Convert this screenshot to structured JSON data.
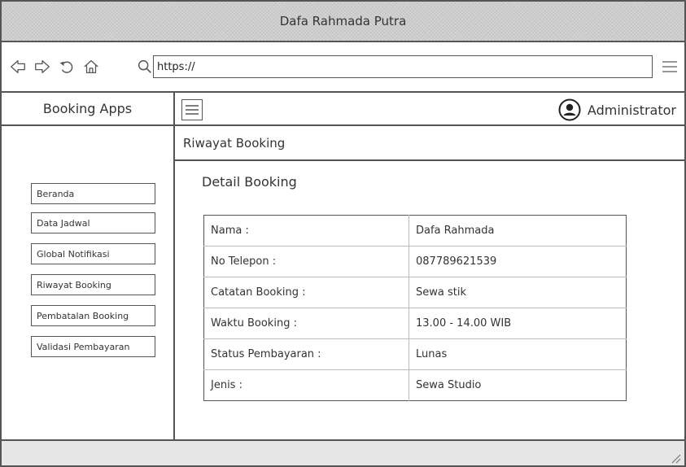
{
  "window": {
    "title": "Dafa Rahmada Putra"
  },
  "addressbar": {
    "url": "https://",
    "icons": [
      "back-icon",
      "forward-icon",
      "reload-icon",
      "home-icon",
      "search-icon",
      "menu-icon"
    ]
  },
  "sidebar": {
    "title": "Booking Apps",
    "items": [
      {
        "label": "Beranda"
      },
      {
        "label": "Data Jadwal"
      },
      {
        "label": "Global Notifikasi"
      },
      {
        "label": "Riwayat Booking"
      },
      {
        "label": "Pembatalan Booking"
      },
      {
        "label": "Validasi Pembayaran"
      }
    ]
  },
  "topbar": {
    "user": "Administrator"
  },
  "page": {
    "breadcrumb": "Riwayat Booking",
    "title": "Detail Booking"
  },
  "detail": {
    "rows": [
      {
        "key": "Nama :",
        "value": "Dafa Rahmada"
      },
      {
        "key": "No Telepon :",
        "value": "087789621539"
      },
      {
        "key": "Catatan Booking :",
        "value": "Sewa stik"
      },
      {
        "key": "Waktu Booking :",
        "value": "13.00 - 14.00 WIB"
      },
      {
        "key": "Status Pembayaran :",
        "value": "Lunas"
      },
      {
        "key": "Jenis :",
        "value": "Sewa Studio"
      }
    ]
  }
}
